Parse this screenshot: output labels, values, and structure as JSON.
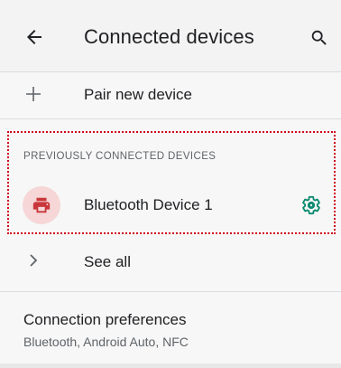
{
  "header": {
    "title": "Connected devices",
    "back_icon": "arrow-back-icon",
    "search_icon": "search-icon"
  },
  "pair": {
    "label": "Pair new device",
    "icon": "plus-icon"
  },
  "previous": {
    "header": "PREVIOUSLY CONNECTED DEVICES",
    "devices": [
      {
        "name": "Bluetooth Device 1",
        "icon": "printer-icon",
        "settings_icon": "gear-icon"
      }
    ],
    "see_all_label": "See all"
  },
  "preferences": {
    "title": "Connection preferences",
    "subtitle": "Bluetooth, Android Auto, NFC"
  },
  "colors": {
    "accent": "#0b8a6f",
    "device_icon": "#c8373b",
    "device_icon_bg": "#f6d6d6",
    "highlight_border": "#d0021b"
  }
}
